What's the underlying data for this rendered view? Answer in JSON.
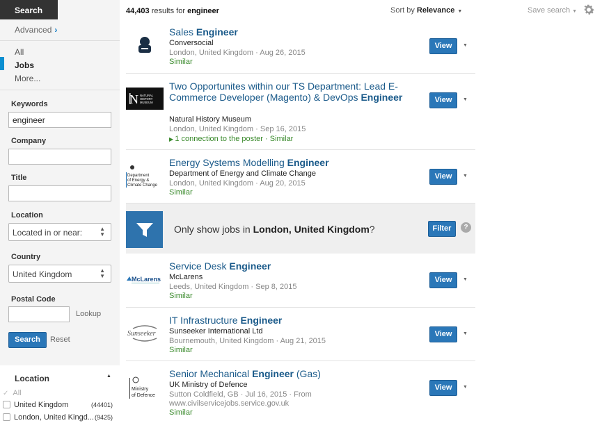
{
  "sidebar": {
    "search_tab": "Search",
    "advanced": "Advanced",
    "types": [
      "All",
      "Jobs",
      "More..."
    ],
    "fields": {
      "keywords_label": "Keywords",
      "keywords_value": "engineer",
      "company_label": "Company",
      "title_label": "Title",
      "location_label": "Location",
      "location_value": "Located in or near:",
      "country_label": "Country",
      "country_value": "United Kingdom",
      "postal_label": "Postal Code",
      "lookup": "Lookup"
    },
    "search_button": "Search",
    "reset": "Reset",
    "facet": {
      "title": "Location",
      "items": [
        {
          "label": "All",
          "count": ""
        },
        {
          "label": "United Kingdom",
          "count": "(44401)"
        },
        {
          "label": "London, United Kingd...",
          "count": "(9425)"
        }
      ]
    }
  },
  "header": {
    "count": "44,403",
    "results_for": "results for",
    "query": "engineer",
    "sort_prefix": "Sort by",
    "sort_value": "Relevance",
    "save_search": "Save search"
  },
  "jobs": [
    {
      "title_pre": "Sales ",
      "title_em": "Engineer",
      "title_post": "",
      "company": "Conversocial",
      "meta": "London, United Kingdom · Aug 26, 2015",
      "extra": "",
      "similar": "Similar",
      "view": "View"
    },
    {
      "title_pre": "Two Opportunites within our TS Department: Lead E-Commerce Developer (Magento) & DevOps ",
      "title_em": "Engineer",
      "title_post": "",
      "company": "Natural History Museum",
      "meta": "London, United Kingdom · Sep 16, 2015",
      "extra": "",
      "similar": "1 connection to the poster · Similar",
      "view": "View",
      "logo_text": "NATURAL HISTORY MUSEUM"
    },
    {
      "title_pre": "Energy Systems Modelling ",
      "title_em": "Engineer",
      "title_post": "",
      "company": "Department of Energy and Climate Change",
      "meta": "London, United Kingdom · Aug 20, 2015",
      "extra": "",
      "similar": "Similar",
      "view": "View",
      "logo_text": "Department of Energy & Climate Change"
    },
    {
      "title_pre": "Service Desk ",
      "title_em": "Engineer",
      "title_post": "",
      "company": "McLarens",
      "meta": "Leeds, United Kingdom · Sep 8, 2015",
      "extra": "",
      "similar": "Similar",
      "view": "View",
      "logo_text": "McLarens"
    },
    {
      "title_pre": "IT Infrastructure ",
      "title_em": "Engineer",
      "title_post": "",
      "company": "Sunseeker International Ltd",
      "meta": "Bournemouth, United Kingdom · Aug 21, 2015",
      "extra": "",
      "similar": "Similar",
      "view": "View",
      "logo_text": "Sunseeker"
    },
    {
      "title_pre": "Senior Mechanical ",
      "title_em": "Engineer",
      "title_post": " (Gas)",
      "company": "UK Ministry of Defence",
      "meta": "Sutton Coldfield, GB · Jul 16, 2015 · From",
      "extra": "www.civilservicejobs.service.gov.uk",
      "similar": "Similar",
      "view": "View",
      "logo_text": "Ministry of Defence"
    }
  ],
  "filter_banner": {
    "text_pre": "Only show jobs in ",
    "text_bold": "London, United Kingdom",
    "text_post": "?",
    "button": "Filter",
    "help": "?"
  },
  "colors": {
    "accent_blue": "#2a77b8",
    "link_blue": "#1a5a8a",
    "green": "#3a8a2c",
    "sidebar_bg": "#f4f4f4"
  }
}
